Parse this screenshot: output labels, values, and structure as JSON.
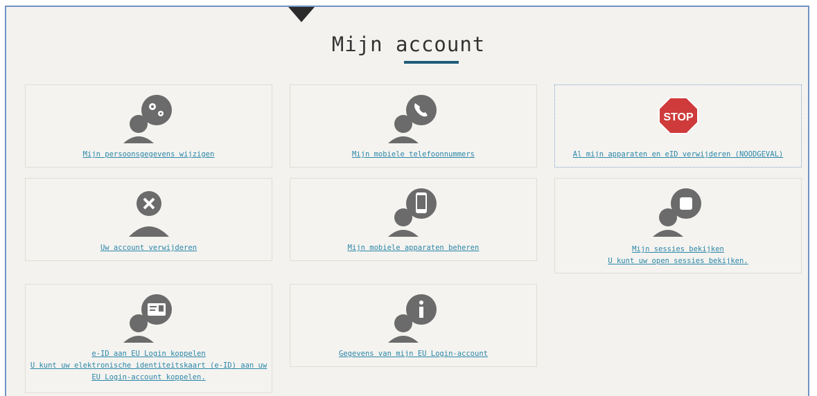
{
  "page": {
    "title": "Mijn account"
  },
  "tiles": [
    {
      "icon": "person-gears-icon",
      "lines": [
        "Mijn persoonsgegevens wijzigen"
      ]
    },
    {
      "icon": "person-phone-icon",
      "lines": [
        "Mijn mobiele telefoonnummers"
      ]
    },
    {
      "icon": "stop-sign-icon",
      "icon_text": "STOP",
      "lines": [
        "Al mijn apparaten en eID verwijderen (NOODGEVAL)"
      ]
    },
    {
      "icon": "person-delete-icon",
      "lines": [
        "Uw account verwijderen"
      ]
    },
    {
      "icon": "person-mobile-device-icon",
      "lines": [
        "Mijn mobiele apparaten beheren"
      ]
    },
    {
      "icon": "person-session-icon",
      "lines": [
        "Mijn sessies bekijken",
        "U kunt uw open sessies bekijken."
      ]
    },
    {
      "icon": "person-id-card-icon",
      "lines": [
        "e-ID aan EU Login koppelen",
        "U kunt uw elektronische identiteitskaart (e-ID) aan uw",
        "EU Login-account koppelen."
      ]
    },
    {
      "icon": "person-info-icon",
      "lines": [
        "Gegevens van mijn EU Login-account"
      ]
    }
  ],
  "colors": {
    "link": "#2b86a8",
    "accent": "#1f5b79",
    "icon": "#6b6b6b",
    "stop": "#cf3a3a"
  }
}
